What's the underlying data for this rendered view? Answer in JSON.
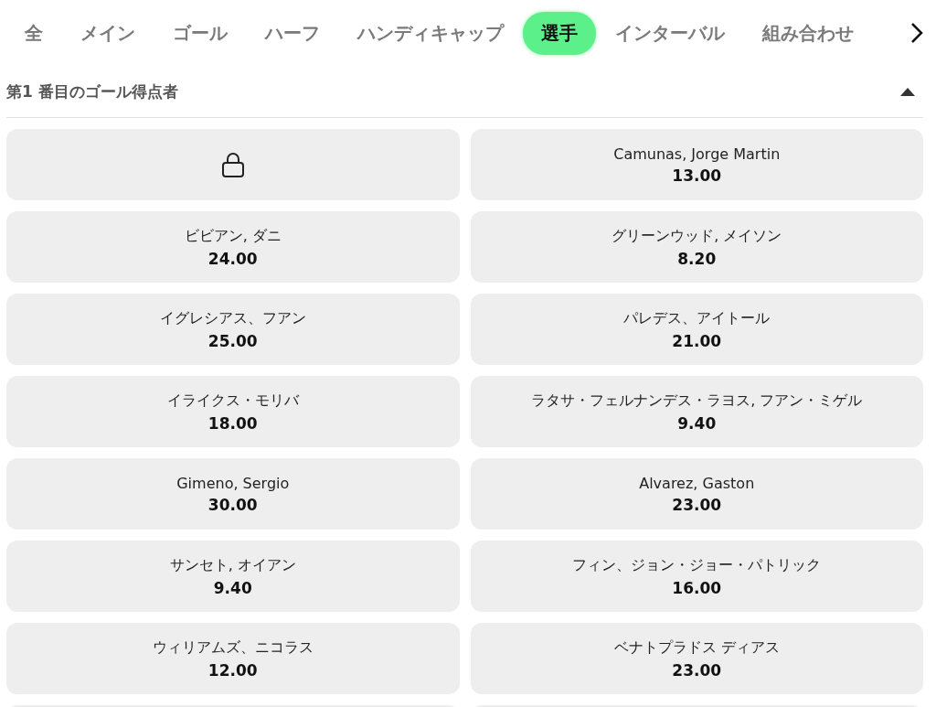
{
  "tabs": [
    {
      "label": "全",
      "selected": false
    },
    {
      "label": "メイン",
      "selected": false
    },
    {
      "label": "ゴール",
      "selected": false
    },
    {
      "label": "ハーフ",
      "selected": false
    },
    {
      "label": "ハンディキャップ",
      "selected": false
    },
    {
      "label": "選手",
      "selected": true
    },
    {
      "label": "インターバル",
      "selected": false
    },
    {
      "label": "組み合わせ",
      "selected": false
    }
  ],
  "section": {
    "title": "第1 番目のゴール得点者",
    "expanded": true
  },
  "selections": [
    {
      "kind": "locked"
    },
    {
      "kind": "odds",
      "name": "Camunas, Jorge Martin",
      "odds": "13.00"
    },
    {
      "kind": "odds",
      "name": "ビビアン, ダニ",
      "odds": "24.00"
    },
    {
      "kind": "odds",
      "name": "グリーンウッド, メイソン",
      "odds": "8.20"
    },
    {
      "kind": "odds",
      "name": "イグレシアス、フアン",
      "odds": "25.00"
    },
    {
      "kind": "odds",
      "name": "パレデス、アイトール",
      "odds": "21.00"
    },
    {
      "kind": "odds",
      "name": "イライクス・モリバ",
      "odds": "18.00"
    },
    {
      "kind": "odds",
      "name": "ラタサ・フェルナンデス・ラヨス, フアン・ミゲル",
      "odds": "9.40"
    },
    {
      "kind": "odds",
      "name": "Gimeno, Sergio",
      "odds": "30.00"
    },
    {
      "kind": "odds",
      "name": "Alvarez, Gaston",
      "odds": "23.00"
    },
    {
      "kind": "odds",
      "name": "サンセト, オイアン",
      "odds": "9.40"
    },
    {
      "kind": "odds",
      "name": "フィン、ジョン・ジョー・パトリック",
      "odds": "16.00"
    },
    {
      "kind": "odds",
      "name": "ウィリアムズ、ニコラス",
      "odds": "12.00"
    },
    {
      "kind": "odds",
      "name": "ベナトプラドス ディアス",
      "odds": "23.00"
    },
    {
      "kind": "partial"
    },
    {
      "kind": "partial"
    }
  ]
}
